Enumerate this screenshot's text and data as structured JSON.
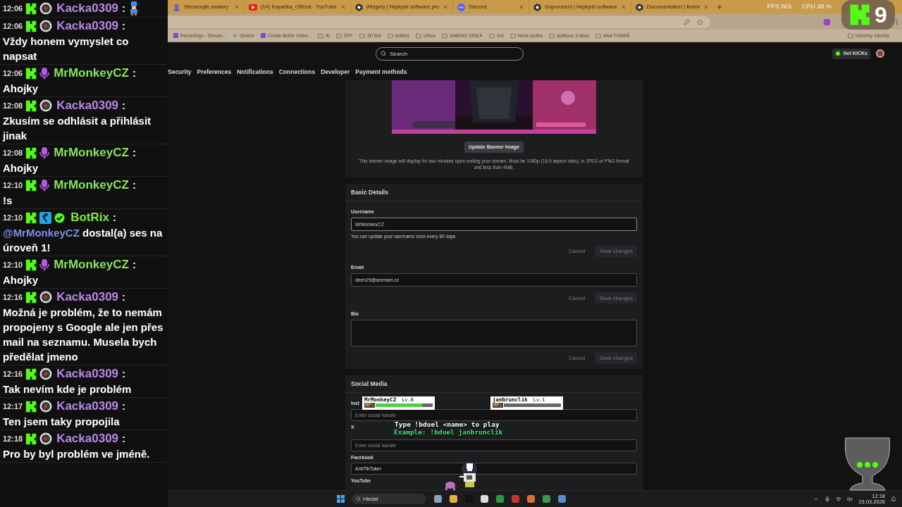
{
  "chat": {
    "messages": [
      {
        "time": "12:06",
        "badges": [
          {
            "kind": "kick"
          },
          {
            "kind": "disc"
          }
        ],
        "user": "Kacka0309",
        "color": "#b98ae6",
        "separator": ":",
        "parts": [
          {
            "kind": "emote"
          }
        ]
      },
      {
        "time": "12:06",
        "badges": [
          {
            "kind": "kick"
          },
          {
            "kind": "disc"
          }
        ],
        "user": "Kacka0309",
        "color": "#b98ae6",
        "separator": ":",
        "parts": [
          {
            "kind": "plain",
            "text": "Vždy honem vymyslet co napsat"
          }
        ]
      },
      {
        "time": "12:06",
        "badges": [
          {
            "kind": "kick"
          },
          {
            "kind": "mic"
          }
        ],
        "user": "MrMonkeyCZ",
        "color": "#86e35c",
        "separator": ":",
        "parts": [
          {
            "kind": "plain",
            "text": "Ahojky"
          }
        ]
      },
      {
        "time": "12:08",
        "badges": [
          {
            "kind": "kick"
          },
          {
            "kind": "disc"
          }
        ],
        "user": "Kacka0309",
        "color": "#b98ae6",
        "separator": ":",
        "parts": [
          {
            "kind": "plain",
            "text": "Zkusím se odhlásit a přihlásit jinak"
          }
        ]
      },
      {
        "time": "12:08",
        "badges": [
          {
            "kind": "kick"
          },
          {
            "kind": "mic"
          }
        ],
        "user": "MrMonkeyCZ",
        "color": "#86e35c",
        "separator": ":",
        "parts": [
          {
            "kind": "plain",
            "text": "Ahojky"
          }
        ]
      },
      {
        "time": "12:10",
        "badges": [
          {
            "kind": "kick"
          },
          {
            "kind": "mic"
          }
        ],
        "user": "MrMonkeyCZ",
        "color": "#86e35c",
        "separator": ":",
        "parts": [
          {
            "kind": "plain",
            "text": "!s"
          }
        ]
      },
      {
        "time": "12:10",
        "badges": [
          {
            "kind": "kick"
          },
          {
            "kind": "hammer"
          },
          {
            "kind": "verified"
          }
        ],
        "user": "BotRix",
        "color": "#7dea3f",
        "separator": ":",
        "parts": [
          {
            "kind": "mention",
            "text": "@MrMonkeyCZ"
          },
          {
            "kind": "plain",
            "text": "dostal(a) ses na úroveň 1!"
          }
        ]
      },
      {
        "time": "12:10",
        "badges": [
          {
            "kind": "kick"
          },
          {
            "kind": "mic"
          }
        ],
        "user": "MrMonkeyCZ",
        "color": "#86e35c",
        "separator": ":",
        "parts": [
          {
            "kind": "plain",
            "text": "Ahojky"
          }
        ]
      },
      {
        "time": "12:16",
        "badges": [
          {
            "kind": "kick"
          },
          {
            "kind": "disc"
          }
        ],
        "user": "Kacka0309",
        "color": "#b98ae6",
        "separator": ":",
        "parts": [
          {
            "kind": "plain",
            "text": "Možná je problém, že to nemám propojeny s Google ale jen přes mail na seznamu. Musela bych předělat jmeno"
          }
        ]
      },
      {
        "time": "12:16",
        "badges": [
          {
            "kind": "kick"
          },
          {
            "kind": "disc"
          }
        ],
        "user": "Kacka0309",
        "color": "#b98ae6",
        "separator": ":",
        "parts": [
          {
            "kind": "plain",
            "text": "Tak nevím kde je problém"
          }
        ]
      },
      {
        "time": "12:17",
        "badges": [
          {
            "kind": "kick"
          },
          {
            "kind": "disc"
          }
        ],
        "user": "Kacka0309",
        "color": "#b98ae6",
        "separator": ":",
        "parts": [
          {
            "kind": "plain",
            "text": "Ten jsem taky propojila"
          }
        ]
      },
      {
        "time": "12:18",
        "badges": [
          {
            "kind": "kick"
          },
          {
            "kind": "disc"
          }
        ],
        "user": "Kacka0309",
        "color": "#b98ae6",
        "separator": ":",
        "parts": [
          {
            "kind": "plain",
            "text": "Pro by byl problém ve jméně."
          }
        ]
      }
    ]
  },
  "browser": {
    "tabs": [
      {
        "title": "Streamujte avatary",
        "kind": "avatar",
        "selected": false
      },
      {
        "title": "(14) Kopačka_Official - YouTube",
        "kind": "youtube",
        "selected": false
      },
      {
        "title": "Widgety | Nejlepší software pro",
        "kind": "bot",
        "selected": false
      },
      {
        "title": "Discord",
        "kind": "discord",
        "selected": false
      },
      {
        "title": "Doporučení | Nejlepší software",
        "kind": "bot",
        "selected": false
      },
      {
        "title": "Documentation | Botrix",
        "kind": "bot",
        "selected": false
      }
    ],
    "bookmarks": [
      {
        "label": "Recordings - Stream...",
        "kind": "app"
      },
      {
        "label": "Gemini",
        "kind": "spark"
      },
      {
        "label": "Create Better Video...",
        "kind": "app"
      },
      {
        "label": "AI",
        "kind": "folder"
      },
      {
        "label": "DTF",
        "kind": "folder"
      },
      {
        "label": "3D tisk",
        "kind": "folder"
      },
      {
        "label": "češtiny",
        "kind": "folder"
      },
      {
        "label": "Urbex",
        "kind": "folder"
      },
      {
        "label": "DABING VIDEA",
        "kind": "folder"
      },
      {
        "label": "Gril",
        "kind": "folder"
      },
      {
        "label": "Nová složka",
        "kind": "folder"
      },
      {
        "label": "Aplikace 3 stran",
        "kind": "folder"
      },
      {
        "label": "AAA TOMÁŠ",
        "kind": "folder"
      }
    ],
    "all_bookmarks": "Všechny záložky"
  },
  "stream_stats": [
    "FPS N/A",
    "CPU 36 %"
  ],
  "kick_counter": "9",
  "site": {
    "search": {
      "placeholder": "Search"
    },
    "get_kicks": "Get KICKs",
    "settings_tabs": [
      {
        "label": "Security",
        "selected": false
      },
      {
        "label": "Preferences",
        "selected": false
      },
      {
        "label": "Notifications",
        "selected": false
      },
      {
        "label": "Connections",
        "selected": false
      },
      {
        "label": "Developer",
        "selected": false
      },
      {
        "label": "Payment methods",
        "selected": false
      }
    ],
    "banner": {
      "kind": "picture",
      "button": "Update Banner Image",
      "note": "This banner image will display for two minutes upon ending your stream. Must be 1080p (16:9 aspect ratio), in JPEG or PNG format and less than 4MB."
    },
    "basic_details": {
      "title": "Basic Details",
      "fields": [
        {
          "label": "Username",
          "kind": "input",
          "value": "MrMonkeyCZ",
          "hint": "You can update your username once every 60 days.",
          "cancel": "Cancel",
          "save": "Save changes",
          "disabled": true
        },
        {
          "label": "Email",
          "kind": "input",
          "value": "deen29@seznam.cz",
          "cancel": "Cancel",
          "save": "Save changes",
          "disabled": true
        },
        {
          "label": "Bio",
          "kind": "textarea",
          "cancel": "Cancel",
          "save": "Save changes",
          "disabled": true
        }
      ]
    },
    "social_media": {
      "title": "Social Media",
      "fields": [
        {
          "label": "Inst",
          "placeholder": "Enter social handle"
        },
        {
          "label": "X",
          "placeholder": "Enter social handle"
        },
        {
          "label": "Facebook",
          "value": "AntiTikToker"
        },
        {
          "label": "YouTube"
        }
      ]
    }
  },
  "duel": {
    "players": [
      {
        "name": "MrMonkeyCZ",
        "lv": "Lv.6",
        "hp": "HP:",
        "level": 0.82
      },
      {
        "name": "janbrunclik",
        "lv": "Lv.1",
        "hp": "HP:",
        "level": 0
      }
    ],
    "instruction": "Type !bduel <name> to play",
    "example": "Example: !bduel janbrunclik"
  },
  "taskbar": {
    "search": {
      "placeholder": "Hledat"
    },
    "time": "12:18",
    "date": "23.03.2026"
  }
}
